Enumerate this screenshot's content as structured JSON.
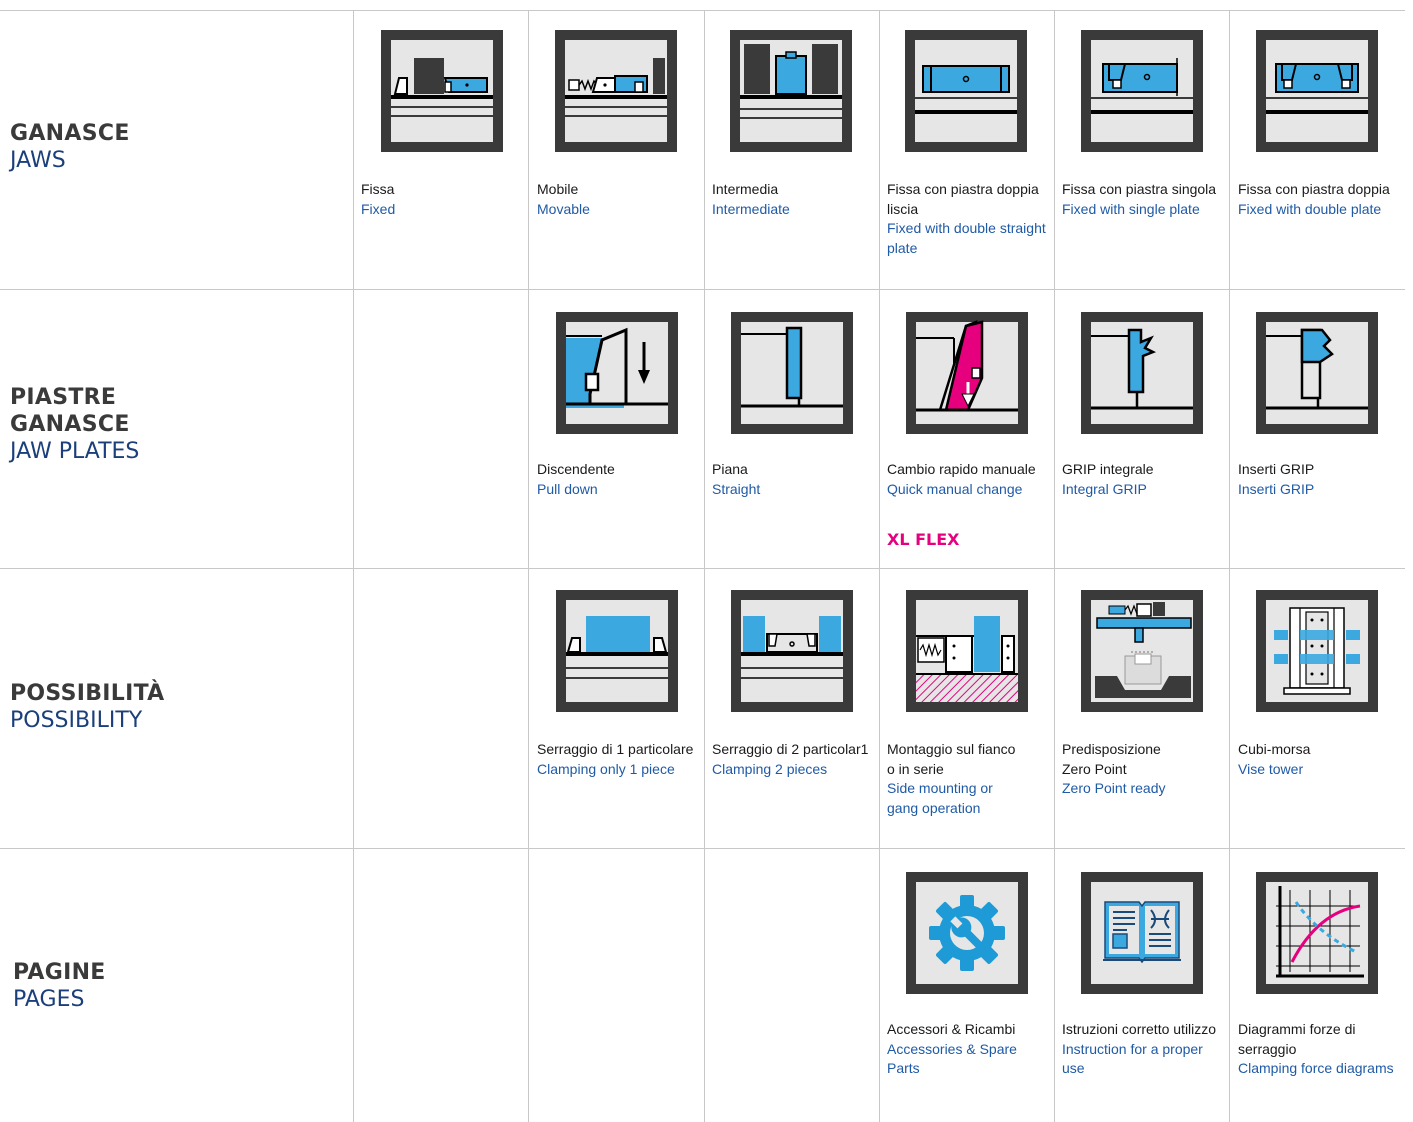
{
  "sections": {
    "jaws": {
      "it": "GANASCE",
      "en": "JAWS"
    },
    "plates": {
      "it1": "PIASTRE",
      "it2": "GANASCE",
      "en": "JAW PLATES"
    },
    "possibility": {
      "it": "POSSIBILITÀ",
      "en": "POSSIBILITY"
    },
    "pages": {
      "it": "PAGINE",
      "en": "PAGES"
    }
  },
  "jaws": [
    {
      "it": "Fissa",
      "en": "Fixed"
    },
    {
      "it": "Mobile",
      "en": "Movable"
    },
    {
      "it": "Intermedia",
      "en": "Intermediate"
    },
    {
      "it": "Fissa con piastra doppia liscia",
      "en": "Fixed with double straight plate"
    },
    {
      "it": "Fissa con piastra singola",
      "en": "Fixed with single plate"
    },
    {
      "it": "Fissa con piastra doppia",
      "en": "Fixed with double plate"
    }
  ],
  "plates": [
    {
      "it": "Discendente",
      "en": "Pull down"
    },
    {
      "it": "Piana",
      "en": "Straight"
    },
    {
      "it": "Cambio rapido manuale",
      "en": "Quick manual change"
    },
    {
      "it": "GRIP integrale",
      "en": "Integral GRIP"
    },
    {
      "it": "Inserti GRIP",
      "en": "Inserti GRIP"
    }
  ],
  "plates_tag": "XL FLEX",
  "possibility": [
    {
      "it": "Serraggio di 1 particolare",
      "en": "Clamping only 1 piece"
    },
    {
      "it": "Serraggio di 2 particolar1",
      "en": "Clamping 2 pieces"
    },
    {
      "it1": "Montaggio sul fianco",
      "it2": "o in serie",
      "en1": "Side mounting or",
      "en2": "gang operation"
    },
    {
      "it1": "Predisposizione",
      "it2": "Zero Point",
      "en": "Zero Point ready"
    },
    {
      "it": "Cubi-morsa",
      "en": "Vise tower"
    }
  ],
  "pages": [
    {
      "it": "Accessori & Ricambi",
      "en": "Accessories & Spare Parts"
    },
    {
      "it": "Istruzioni corretto utilizzo",
      "en": "Instruction for a proper use"
    },
    {
      "it": "Diagrammi forze di serraggio",
      "en": "Clamping force diagrams"
    }
  ],
  "colors": {
    "blue": "#3ba9e0",
    "frame": "#3a3a3a",
    "panel": "#e6e6e6",
    "magenta": "#e6007e",
    "title_blue": "#1b3f7a",
    "caption_blue": "#1f5aa6"
  }
}
